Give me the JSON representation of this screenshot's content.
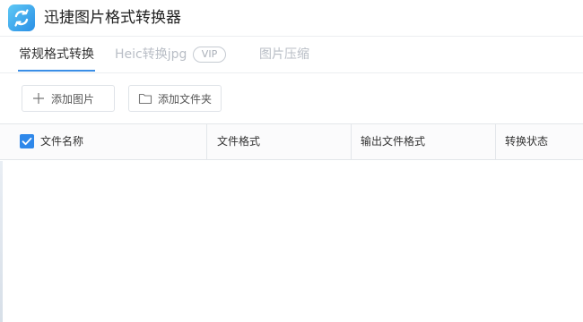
{
  "app": {
    "title": "迅捷图片格式转换器",
    "logo_icon": "refresh-arrows-icon"
  },
  "tabs": [
    {
      "label": "常规格式转换",
      "active": true
    },
    {
      "label": "Heic转换jpg",
      "badge": "VIP",
      "active": false
    },
    {
      "label": "图片压缩",
      "active": false
    }
  ],
  "toolbar": {
    "add_image": {
      "label": "添加图片",
      "icon": "plus-icon"
    },
    "add_folder": {
      "label": "添加文件夹",
      "icon": "folder-icon"
    }
  },
  "table": {
    "select_all_checked": true,
    "columns": [
      "文件名称",
      "文件格式",
      "输出文件格式",
      "转换状态"
    ],
    "rows": []
  },
  "colors": {
    "accent": "#2f88ea",
    "muted_text": "#b9bec6"
  }
}
